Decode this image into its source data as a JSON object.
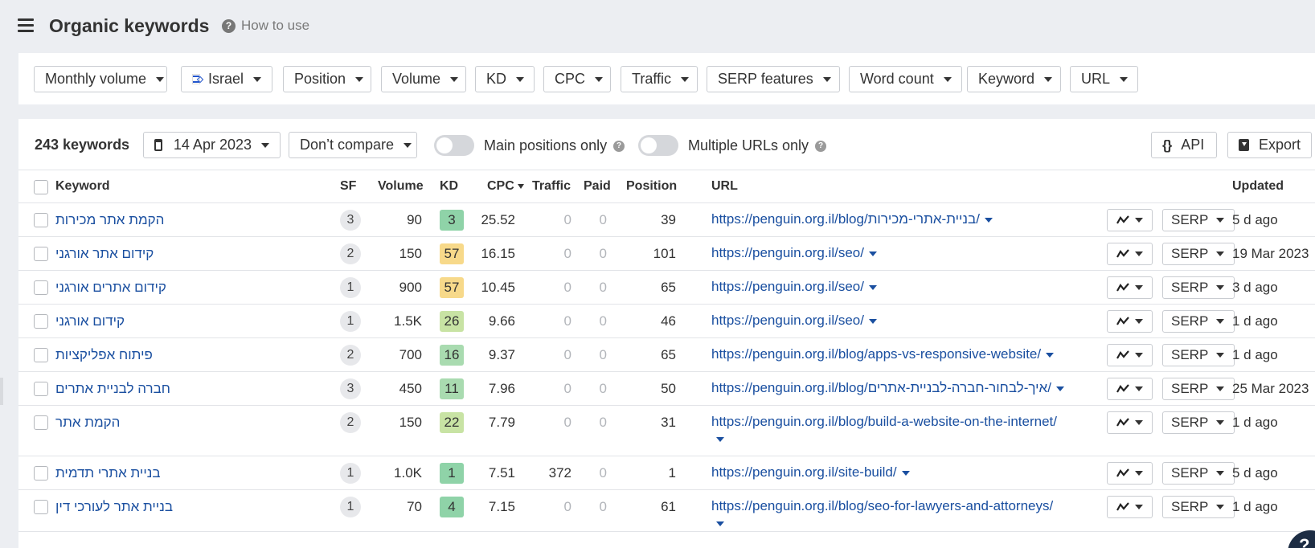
{
  "header": {
    "title": "Organic keywords",
    "how_to_use": "How to use"
  },
  "filters": {
    "monthly_volume": "Monthly volume",
    "country": "Israel",
    "position": "Position",
    "volume": "Volume",
    "kd": "KD",
    "cpc": "CPC",
    "traffic": "Traffic",
    "serp_features": "SERP features",
    "word_count": "Word count",
    "keyword": "Keyword",
    "url": "URL"
  },
  "toolbar": {
    "count": "243 keywords",
    "date": "14 Apr 2023",
    "compare": "Don’t compare",
    "main_positions": "Main positions only",
    "multiple_urls": "Multiple URLs only",
    "api": "API",
    "export": "Export"
  },
  "columns": {
    "keyword": "Keyword",
    "sf": "SF",
    "volume": "Volume",
    "kd": "KD",
    "cpc": "CPC",
    "traffic": "Traffic",
    "paid": "Paid",
    "position": "Position",
    "url": "URL",
    "updated": "Updated"
  },
  "colors": {
    "kd_green": "#8fd3a8",
    "kd_lightgreen": "#c8e3a4",
    "kd_yellow": "#f7d98a",
    "link": "#1a4fa0"
  },
  "rows": [
    {
      "keyword": "הקמת אתר מכירות",
      "sf": "3",
      "volume": "90",
      "kd": "3",
      "kd_color": "#8fd3a8",
      "cpc": "25.52",
      "traffic": "0",
      "paid": "0",
      "position": "39",
      "url": "https://penguin.org.il/blog/בניית-אתרי-מכירות/",
      "serp": "SERP",
      "updated": "5 d ago"
    },
    {
      "keyword": "קידום אתר אורגני",
      "sf": "2",
      "volume": "150",
      "kd": "57",
      "kd_color": "#f7d98a",
      "cpc": "16.15",
      "traffic": "0",
      "paid": "0",
      "position": "101",
      "url": "https://penguin.org.il/seo/",
      "serp": "SERP",
      "updated": "19 Mar 2023"
    },
    {
      "keyword": "קידום אתרים אורגני",
      "sf": "1",
      "volume": "900",
      "kd": "57",
      "kd_color": "#f7d98a",
      "cpc": "10.45",
      "traffic": "0",
      "paid": "0",
      "position": "65",
      "url": "https://penguin.org.il/seo/",
      "serp": "SERP",
      "updated": "3 d ago"
    },
    {
      "keyword": "קידום אורגני",
      "sf": "1",
      "volume": "1.5K",
      "kd": "26",
      "kd_color": "#c8e3a4",
      "cpc": "9.66",
      "traffic": "0",
      "paid": "0",
      "position": "46",
      "url": "https://penguin.org.il/seo/",
      "serp": "SERP",
      "updated": "1 d ago"
    },
    {
      "keyword": "פיתוח אפליקציות",
      "sf": "2",
      "volume": "700",
      "kd": "16",
      "kd_color": "#a9dbb0",
      "cpc": "9.37",
      "traffic": "0",
      "paid": "0",
      "position": "65",
      "url": "https://penguin.org.il/blog/apps-vs-responsive-website/",
      "serp": "SERP",
      "updated": "1 d ago"
    },
    {
      "keyword": "חברה לבניית אתרים",
      "sf": "3",
      "volume": "450",
      "kd": "11",
      "kd_color": "#a9dbb0",
      "cpc": "7.96",
      "traffic": "0",
      "paid": "0",
      "position": "50",
      "url": "https://penguin.org.il/blog/איך-לבחור-חברה-לבניית-אתרים/",
      "serp": "SERP",
      "updated": "25 Mar 2023"
    },
    {
      "keyword": "הקמת אתר",
      "sf": "2",
      "volume": "150",
      "kd": "22",
      "kd_color": "#c8e3a4",
      "cpc": "7.79",
      "traffic": "0",
      "paid": "0",
      "position": "31",
      "url": "https://penguin.org.il/blog/build-a-website-on-the-internet/",
      "serp": "SERP",
      "updated": "1 d ago"
    },
    {
      "keyword": "בניית אתרי תדמית",
      "sf": "1",
      "volume": "1.0K",
      "kd": "1",
      "kd_color": "#8fd3a8",
      "cpc": "7.51",
      "traffic": "372",
      "paid": "0",
      "position": "1",
      "url": "https://penguin.org.il/site-build/",
      "serp": "SERP",
      "updated": "5 d ago"
    },
    {
      "keyword": "בניית אתר לעורכי דין",
      "sf": "1",
      "volume": "70",
      "kd": "4",
      "kd_color": "#8fd3a8",
      "cpc": "7.15",
      "traffic": "0",
      "paid": "0",
      "position": "61",
      "url": "https://penguin.org.il/blog/seo-for-lawyers-and-attorneys/",
      "serp": "SERP",
      "updated": "1 d ago"
    }
  ]
}
